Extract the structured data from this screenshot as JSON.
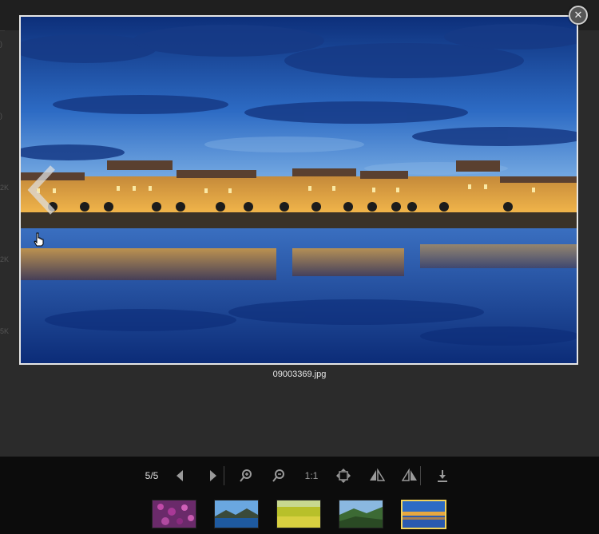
{
  "viewer": {
    "filename": "09003369.jpg",
    "counter": "5/5",
    "zoom_reset_label": "1:1",
    "close_glyph": "✕"
  },
  "icons": {
    "prev": "chevron-left-icon",
    "next": "chevron-right-icon",
    "zoom_in": "zoom-in-icon",
    "zoom_out": "zoom-out-icon",
    "fit": "fit-screen-icon",
    "flip_h": "flip-horizontal-icon",
    "flip_v": "flip-vertical-icon",
    "download": "download-icon"
  },
  "thumbnails": [
    {
      "subject": "purple flowers"
    },
    {
      "subject": "mountain lake"
    },
    {
      "subject": "yellow field"
    },
    {
      "subject": "green hills"
    },
    {
      "subject": "riverside town at night",
      "active": true
    }
  ]
}
